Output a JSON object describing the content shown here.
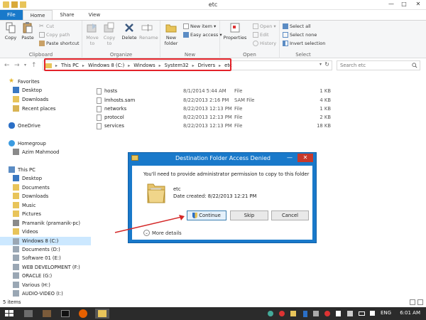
{
  "window": {
    "title": "etc",
    "min": "—",
    "max": "□",
    "close": "✕"
  },
  "tabs": [
    "File",
    "Home",
    "Share",
    "View"
  ],
  "ribbon": {
    "clipboard": {
      "label": "Clipboard",
      "copy": "Copy",
      "paste": "Paste",
      "cut": "Cut",
      "copy_path": "Copy path",
      "paste_shortcut": "Paste shortcut"
    },
    "organize": {
      "label": "Organize",
      "move_to": "Move to",
      "copy_to": "Copy to",
      "delete": "Delete",
      "rename": "Rename"
    },
    "new": {
      "label": "New",
      "new_folder": "New folder",
      "new_item": "New item ▾",
      "easy_access": "Easy access ▾"
    },
    "open": {
      "label": "Open",
      "properties": "Properties",
      "open": "Open ▾",
      "edit": "Edit",
      "history": "History"
    },
    "select": {
      "label": "Select",
      "select_all": "Select all",
      "select_none": "Select none",
      "invert_selection": "Invert selection"
    }
  },
  "address": {
    "crumbs": [
      "This PC",
      "Windows 8 (C:)",
      "Windows",
      "System32",
      "Drivers",
      "etc"
    ],
    "search_placeholder": "Search etc"
  },
  "nav": {
    "favorites": "Favorites",
    "desktop": "Desktop",
    "downloads": "Downloads",
    "recent": "Recent places",
    "onedrive": "OneDrive",
    "homegroup": "Homegroup",
    "user": "Azim Mahmood",
    "this_pc": "This PC",
    "pc_items": [
      "Desktop",
      "Documents",
      "Downloads",
      "Music",
      "Pictures",
      "Pramanik (pramanik-pc)",
      "Videos",
      "Windows 8 (C:)",
      "Documents (D:)",
      "Software 01 (E:)",
      "WEB DEVELOPMENT (F:)",
      "ORACLE (G:)",
      "Various (H:)",
      "AUDIO-VIDEO (I:)"
    ]
  },
  "files": [
    {
      "name": "hosts",
      "date": "8/1/2014 5:44 AM",
      "type": "File",
      "size": "1 KB"
    },
    {
      "name": "lmhosts.sam",
      "date": "8/22/2013 2:16 PM",
      "type": "SAM File",
      "size": "4 KB"
    },
    {
      "name": "networks",
      "date": "8/22/2013 12:13 PM",
      "type": "File",
      "size": "1 KB"
    },
    {
      "name": "protocol",
      "date": "8/22/2013 12:13 PM",
      "type": "File",
      "size": "2 KB"
    },
    {
      "name": "services",
      "date": "8/22/2013 12:13 PM",
      "type": "File",
      "size": "18 KB"
    }
  ],
  "status": {
    "items": "5 items"
  },
  "dialog": {
    "title": "Destination Folder Access Denied",
    "message": "You'll need to provide administrator permission to copy to this folder",
    "folder_name": "etc",
    "date_created": "Date created: 8/22/2013 12:21 PM",
    "continue": "Continue",
    "skip": "Skip",
    "cancel": "Cancel",
    "more_details": "More details",
    "close": "✕",
    "min": "—"
  },
  "taskbar": {
    "lang": "ENG",
    "time": "6:01 AM"
  },
  "colors": {
    "accent": "#1979ca",
    "highlight": "#e3232a"
  }
}
